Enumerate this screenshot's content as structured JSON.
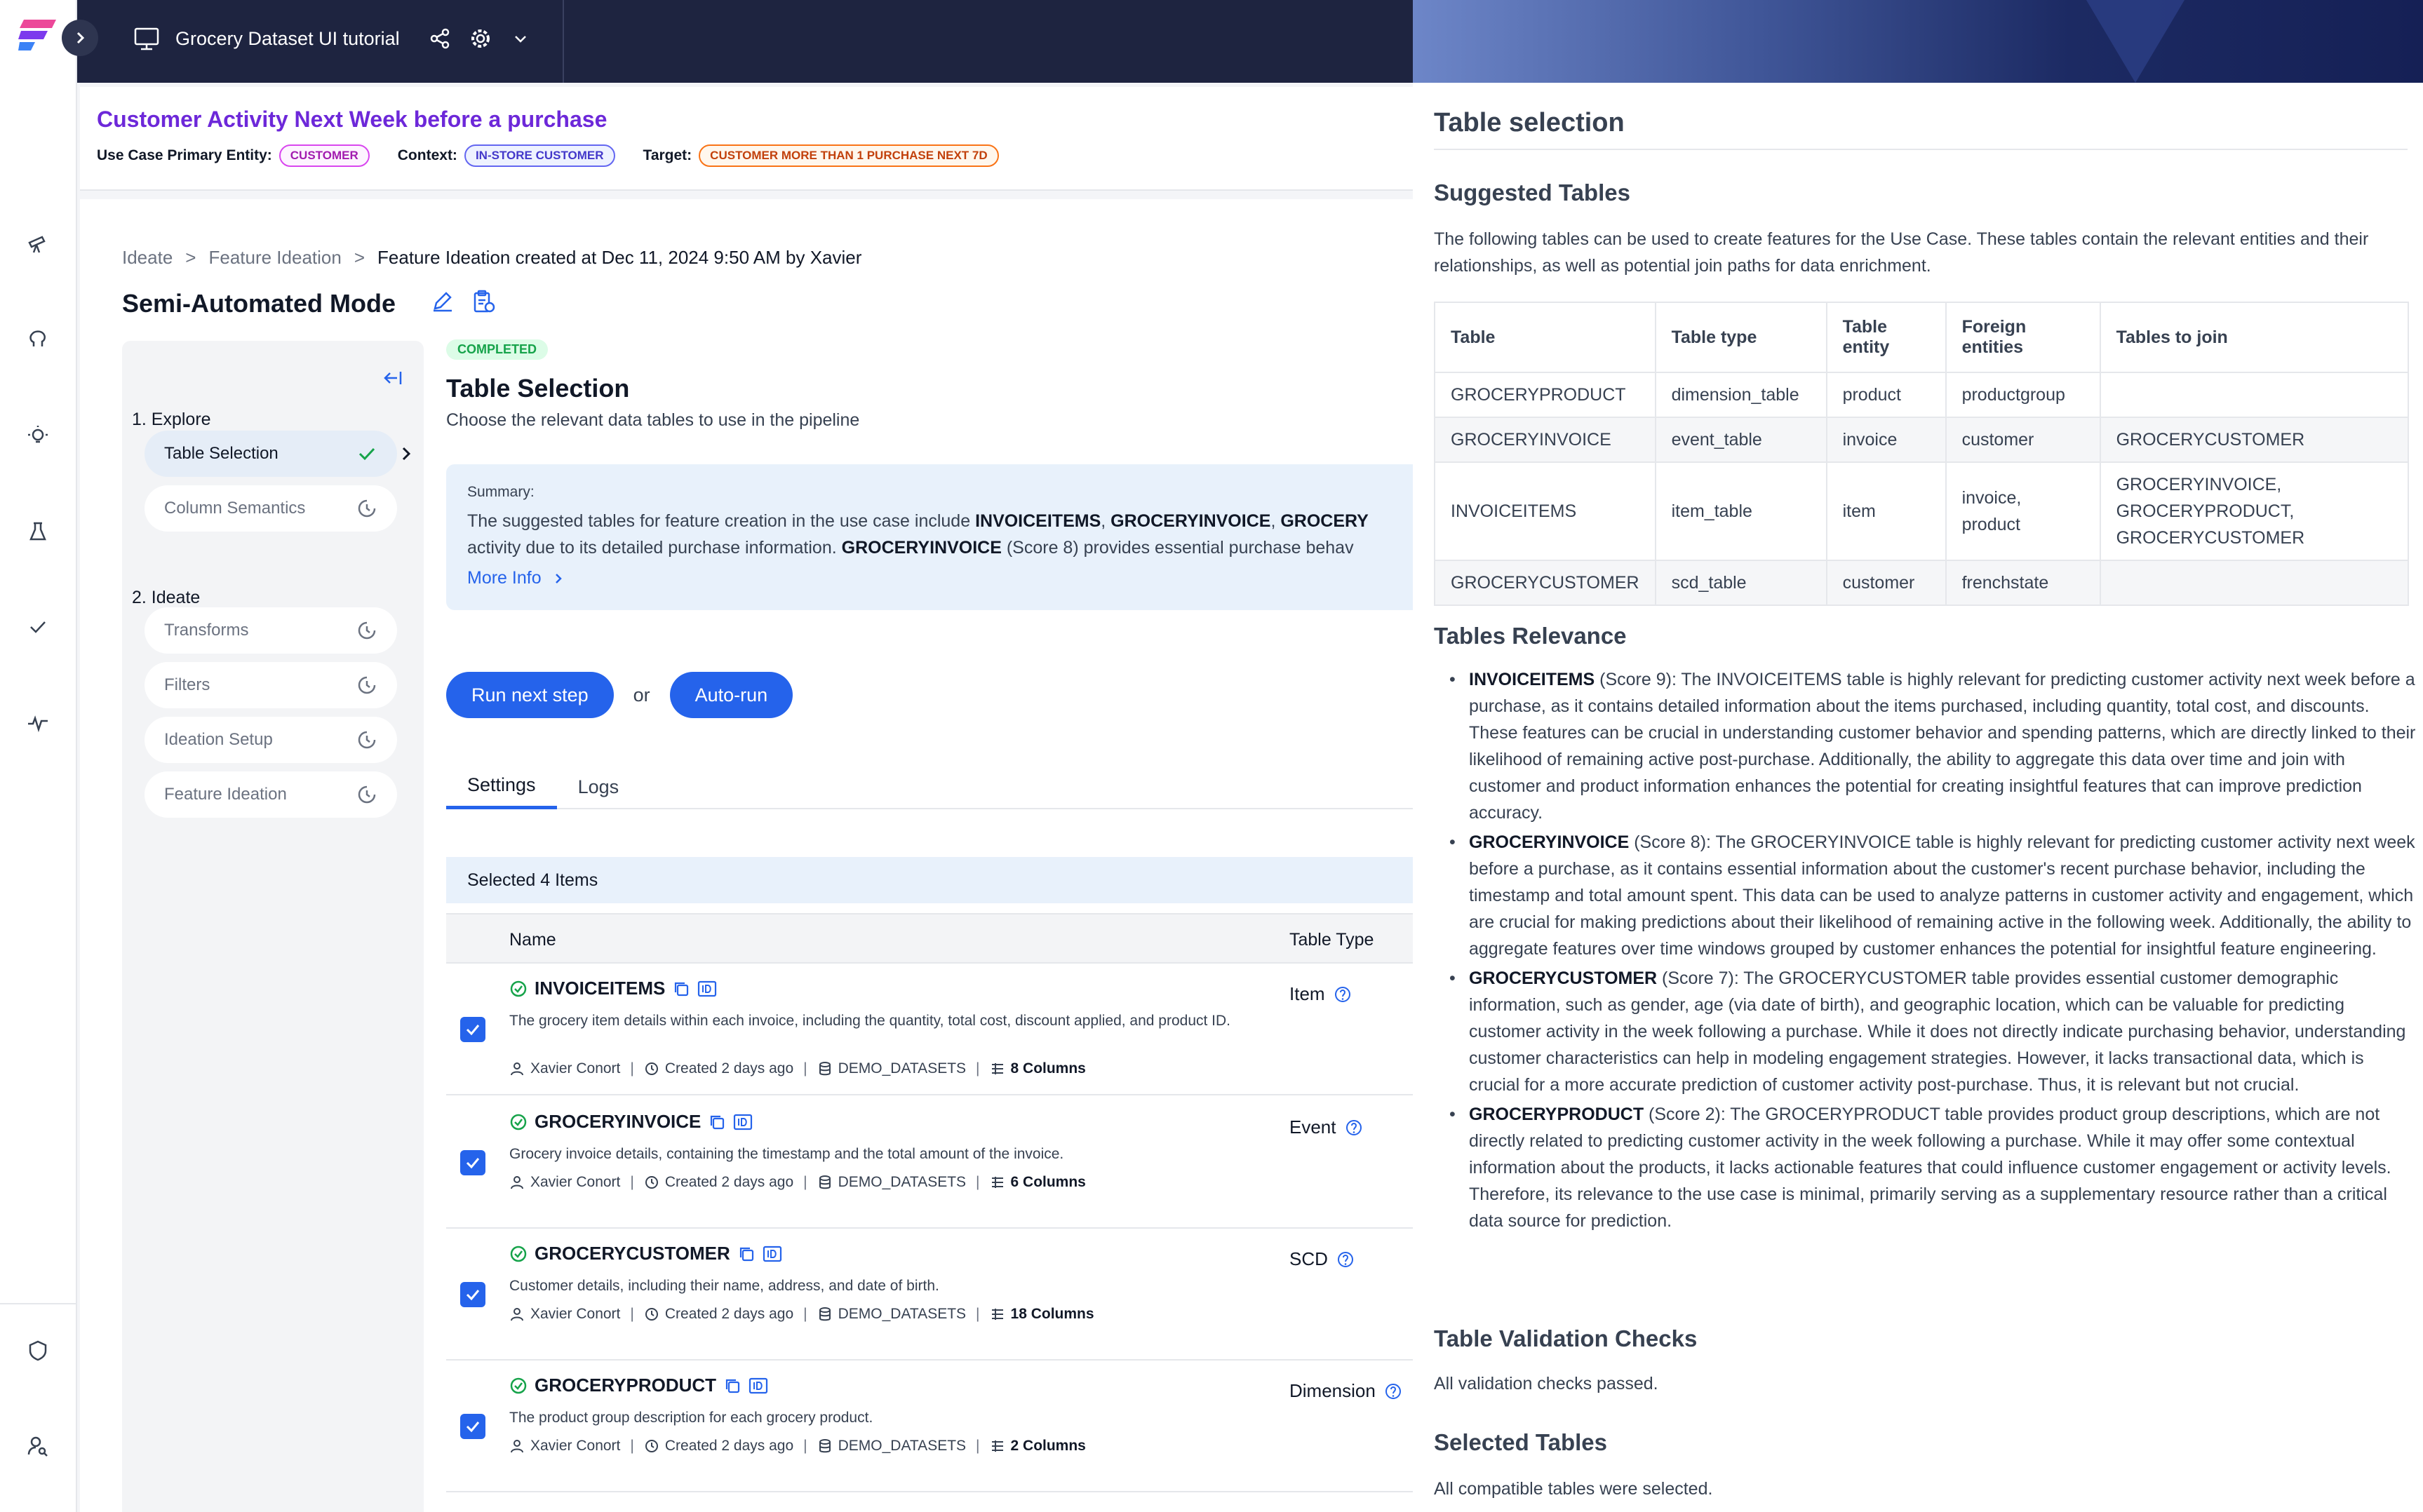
{
  "topbar": {
    "project_title": "Grocery Dataset UI tutorial"
  },
  "header": {
    "use_case_title": "Customer Activity Next Week before a purchase",
    "primary_entity_label": "Use Case Primary Entity:",
    "primary_entity": "CUSTOMER",
    "context_label": "Context:",
    "context": "IN-STORE CUSTOMER",
    "target_label": "Target:",
    "target": "CUSTOMER MORE THAN 1 PURCHASE NEXT 7D"
  },
  "breadcrumb": {
    "items": [
      "Ideate",
      "Feature Ideation"
    ],
    "current": "Feature Ideation created at Dec 11, 2024 9:50 AM by Xavier"
  },
  "mode_title": "Semi-Automated Mode",
  "steps": {
    "explore_label": "1. Explore",
    "ideate_label": "2. Ideate",
    "explore": [
      "Table Selection",
      "Column Semantics"
    ],
    "ideate": [
      "Transforms",
      "Filters",
      "Ideation Setup",
      "Feature Ideation"
    ]
  },
  "step_content": {
    "status": "COMPLETED",
    "title": "Table Selection",
    "subtitle": "Choose the relevant data tables to use in the pipeline",
    "summary_label": "Summary:",
    "summary_line1_a": "The suggested tables for feature creation in the use case include ",
    "summary_line1_b1": "INVOICEITEMS",
    "summary_line1_c": ", ",
    "summary_line1_b2": "GROCERYINVOICE",
    "summary_line1_d": ", ",
    "summary_line1_b3": "GROCERY",
    "summary_line2_a": "activity due to its detailed purchase information. ",
    "summary_line2_b": "GROCERYINVOICE",
    "summary_line2_c": " (Score 8) provides essential purchase behav",
    "more_info": "More Info",
    "run_next": "Run next step",
    "or": "or",
    "auto_run": "Auto-run",
    "tabs": [
      "Settings",
      "Logs"
    ],
    "selected_count": "Selected 4 Items",
    "col_name": "Name",
    "col_type": "Table Type",
    "rows": [
      {
        "name": "INVOICEITEMS",
        "desc": "The grocery item details within each invoice, including the quantity, total cost, discount applied, and product ID.",
        "owner": "Xavier Conort",
        "created": "Created 2 days ago",
        "source": "DEMO_DATASETS",
        "columns": "8 Columns",
        "type": "Item"
      },
      {
        "name": "GROCERYINVOICE",
        "desc": "Grocery invoice details, containing the timestamp and the total amount of the invoice.",
        "owner": "Xavier Conort",
        "created": "Created 2 days ago",
        "source": "DEMO_DATASETS",
        "columns": "6 Columns",
        "type": "Event"
      },
      {
        "name": "GROCERYCUSTOMER",
        "desc": "Customer details, including their name, address, and date of birth.",
        "owner": "Xavier Conort",
        "created": "Created 2 days ago",
        "source": "DEMO_DATASETS",
        "columns": "18 Columns",
        "type": "SCD"
      },
      {
        "name": "GROCERYPRODUCT",
        "desc": "The product group description for each grocery product.",
        "owner": "Xavier Conort",
        "created": "Created 2 days ago",
        "source": "DEMO_DATASETS",
        "columns": "2 Columns",
        "type": "Dimension"
      }
    ]
  },
  "panel": {
    "title": "Table selection",
    "suggested_heading": "Suggested Tables",
    "suggested_text": "The following tables can be used to create features for the Use Case. These tables contain the relevant entities and their relationships, as well as potential join paths for data enrichment.",
    "table_headers": [
      "Table",
      "Table type",
      "Table entity",
      "Foreign entities",
      "Tables to join"
    ],
    "table_rows": [
      [
        "GROCERYPRODUCT",
        "dimension_table",
        "product",
        "productgroup",
        ""
      ],
      [
        "GROCERYINVOICE",
        "event_table",
        "invoice",
        "customer",
        "GROCERYCUSTOMER"
      ],
      [
        "INVOICEITEMS",
        "item_table",
        "item",
        "invoice, product",
        "GROCERYINVOICE, GROCERYPRODUCT, GROCERYCUSTOMER"
      ],
      [
        "GROCERYCUSTOMER",
        "scd_table",
        "customer",
        "frenchstate",
        ""
      ]
    ],
    "relevance_heading": "Tables Relevance",
    "relevance": [
      {
        "name": "INVOICEITEMS",
        "text": " (Score 9): The INVOICEITEMS table is highly relevant for predicting customer activity next week before a purchase, as it contains detailed information about the items purchased, including quantity, total cost, and discounts. These features can be crucial in understanding customer behavior and spending patterns, which are directly linked to their likelihood of remaining active post-purchase. Additionally, the ability to aggregate this data over time and join with customer and product information enhances the potential for creating insightful features that can improve prediction accuracy."
      },
      {
        "name": "GROCERYINVOICE",
        "text": " (Score 8): The GROCERYINVOICE table is highly relevant for predicting customer activity next week before a purchase, as it contains essential information about the customer's recent purchase behavior, including the timestamp and total amount spent. This data can be used to analyze patterns in customer activity and engagement, which are crucial for making predictions about their likelihood of remaining active in the following week. Additionally, the ability to aggregate features over time windows grouped by customer enhances the potential for insightful feature engineering."
      },
      {
        "name": "GROCERYCUSTOMER",
        "text": " (Score 7): The GROCERYCUSTOMER table provides essential customer demographic information, such as gender, age (via date of birth), and geographic location, which can be valuable for predicting customer activity in the week following a purchase. While it does not directly indicate purchasing behavior, understanding customer characteristics can help in modeling engagement strategies. However, it lacks transactional data, which is crucial for a more accurate prediction of customer activity post-purchase. Thus, it is relevant but not crucial."
      },
      {
        "name": "GROCERYPRODUCT",
        "text": " (Score 2): The GROCERYPRODUCT table provides product group descriptions, which are not directly related to predicting customer activity in the week following a purchase. While it may offer some contextual information about the products, it lacks actionable features that could influence customer engagement or activity levels. Therefore, its relevance to the use case is minimal, primarily serving as a supplementary resource rather than a critical data source for prediction."
      }
    ],
    "validation_heading": "Table Validation Checks",
    "validation_text": "All validation checks passed.",
    "selected_heading": "Selected Tables",
    "selected_text": "All compatible tables were selected."
  }
}
